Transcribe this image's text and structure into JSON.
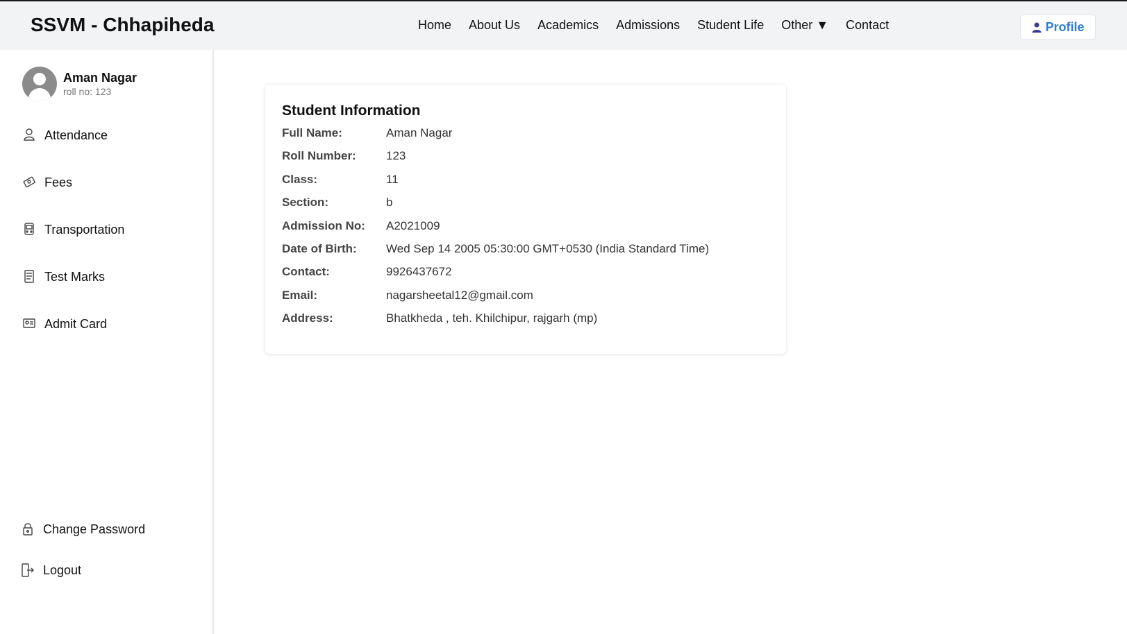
{
  "header": {
    "brand": "SSVM - Chhapiheda",
    "nav": [
      "Home",
      "About Us",
      "Academics",
      "Admissions",
      "Student Life",
      "Other ▼",
      "Contact"
    ],
    "profile_label": "Profile"
  },
  "sidebar": {
    "user_name": "Aman Nagar",
    "user_roll": "roll no: 123",
    "items": [
      {
        "label": "Attendance",
        "icon": "user-icon"
      },
      {
        "label": "Fees",
        "icon": "money-icon"
      },
      {
        "label": "Transportation",
        "icon": "bus-icon"
      },
      {
        "label": "Test Marks",
        "icon": "document-icon"
      },
      {
        "label": "Admit Card",
        "icon": "id-card-icon"
      }
    ],
    "bottom_items": [
      {
        "label": "Change Password",
        "icon": "lock-icon"
      },
      {
        "label": "Logout",
        "icon": "logout-icon"
      }
    ]
  },
  "student_info": {
    "title": "Student Information",
    "rows": [
      {
        "label": "Full Name:",
        "value": "Aman Nagar"
      },
      {
        "label": "Roll Number:",
        "value": "123"
      },
      {
        "label": "Class:",
        "value": "11"
      },
      {
        "label": "Section:",
        "value": "b"
      },
      {
        "label": "Admission No:",
        "value": "A2021009"
      },
      {
        "label": "Date of Birth:",
        "value": "Wed Sep 14 2005 05:30:00 GMT+0530 (India Standard Time)"
      },
      {
        "label": "Contact:",
        "value": "9926437672"
      },
      {
        "label": "Email:",
        "value": "nagarsheetal12@gmail.com"
      },
      {
        "label": "Address:",
        "value": "Bhatkheda , teh. Khilchipur, rajgarh (mp)"
      }
    ]
  },
  "colors": {
    "accent": "#2f7fd1",
    "header_bg": "#f2f3f5"
  }
}
